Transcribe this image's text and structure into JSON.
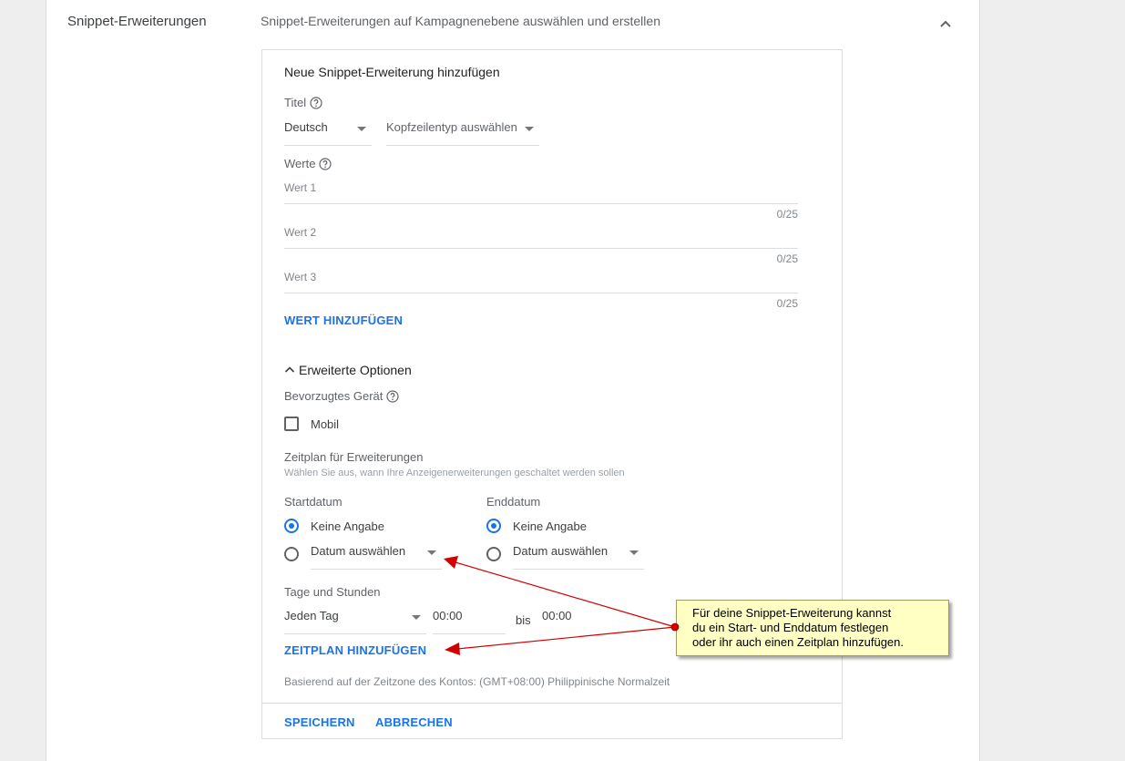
{
  "section": {
    "label": "Snippet-Erweiterungen",
    "description": "Snippet-Erweiterungen auf Kampagnenebene auswählen und erstellen"
  },
  "panel": {
    "title": "Neue Snippet-Erweiterung hinzufügen",
    "title_label": "Titel",
    "language": "Deutsch",
    "header_type": "Kopfzeilentyp auswählen",
    "values_label": "Werte",
    "values": [
      {
        "placeholder": "Wert 1",
        "counter": "0/25"
      },
      {
        "placeholder": "Wert 2",
        "counter": "0/25"
      },
      {
        "placeholder": "Wert 3",
        "counter": "0/25"
      }
    ],
    "add_value": "WERT HINZUFÜGEN",
    "advanced_options": "Erweiterte Optionen",
    "preferred_device": "Bevorzugtes Gerät",
    "mobile": "Mobil",
    "schedule_title": "Zeitplan für Erweiterungen",
    "schedule_hint": "Wählen Sie aus, wann Ihre Anzeigenerweiterungen geschaltet werden sollen",
    "start_date": {
      "label": "Startdatum",
      "none": "Keine Angabe",
      "pick": "Datum auswählen"
    },
    "end_date": {
      "label": "Enddatum",
      "none": "Keine Angabe",
      "pick": "Datum auswählen"
    },
    "days_hours": "Tage und Stunden",
    "day_select": "Jeden Tag",
    "time_from": "00:00",
    "to": "bis",
    "time_to": "00:00",
    "add_schedule": "ZEITPLAN HINZUFÜGEN",
    "timezone_note": "Basierend auf der Zeitzone des Kontos: (GMT+08:00) Philippinische Normalzeit",
    "save": "SPEICHERN",
    "cancel": "ABBRECHEN"
  },
  "callout": {
    "lines": [
      "Für deine Snippet-Erweiterung kannst",
      "du ein Start- und Enddatum festlegen",
      "oder ihr auch einen Zeitplan hinzufügen."
    ]
  },
  "colors": {
    "accent": "#1a73e8",
    "callout_bg": "#ffffc4",
    "arrow": "#d40000"
  }
}
